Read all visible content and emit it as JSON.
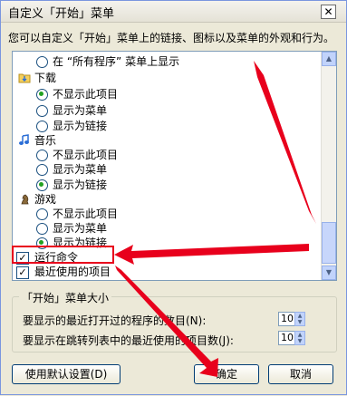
{
  "window": {
    "title": "自定义「开始」菜单",
    "close_glyph": "✕"
  },
  "description": "您可以自定义「开始」菜单上的链接、图标以及菜单的外观和行为。",
  "list": {
    "top_item": "在 “所有程序” 菜单上显示",
    "downloads": {
      "label": "下载",
      "options": [
        "不显示此项目",
        "显示为菜单",
        "显示为链接"
      ]
    },
    "music": {
      "label": "音乐",
      "options": [
        "不显示此项目",
        "显示为菜单",
        "显示为链接"
      ]
    },
    "games": {
      "label": "游戏",
      "options": [
        "不显示此项目",
        "显示为菜单",
        "显示为链接"
      ]
    },
    "run_command": {
      "label": "运行命令",
      "checked": true
    },
    "recent_items": {
      "label": "最近使用的项目",
      "checked": true
    }
  },
  "size_group": {
    "legend": "「开始」菜单大小",
    "recent_programs_label": "要显示的最近打开过的程序的数目(N):",
    "recent_programs_value": "10",
    "jumplist_label": "要显示在跳转列表中的最近使用的项目数(J):",
    "jumplist_value": "10"
  },
  "buttons": {
    "defaults": "使用默认设置(D)",
    "ok": "确定",
    "cancel": "取消"
  },
  "colors": {
    "annotation_red": "#e8001c",
    "radio_green": "#21a121"
  }
}
